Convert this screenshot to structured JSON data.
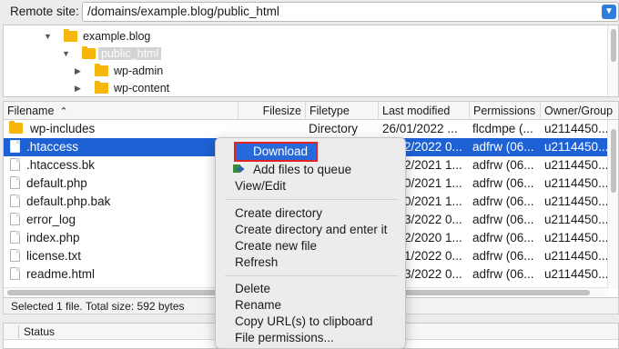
{
  "remote": {
    "label": "Remote site:",
    "path": "/domains/example.blog/public_html"
  },
  "tree": [
    {
      "label": "example.blog",
      "expanded": true
    },
    {
      "label": "public_html",
      "expanded": true,
      "selected": true
    },
    {
      "label": "wp-admin",
      "expanded": false
    },
    {
      "label": "wp-content",
      "expanded": false
    }
  ],
  "columns": {
    "filename": "Filename",
    "filesize": "Filesize",
    "filetype": "Filetype",
    "last_modified": "Last modified",
    "permissions": "Permissions",
    "owner": "Owner/Group"
  },
  "files": [
    {
      "name": "wp-includes",
      "type": "Directory",
      "modified": "26/01/2022 ...",
      "perms": "flcdmpe (...",
      "owner": "u2114450..."
    },
    {
      "name": ".htaccess",
      "type": "",
      "modified": "2/2022 0...",
      "perms": "adfrw (06...",
      "owner": "u2114450..."
    },
    {
      "name": ".htaccess.bk",
      "type": "",
      "modified": "2/2021 1...",
      "perms": "adfrw (06...",
      "owner": "u2114450..."
    },
    {
      "name": "default.php",
      "type": "",
      "modified": "0/2021 1...",
      "perms": "adfrw (06...",
      "owner": "u2114450..."
    },
    {
      "name": "default.php.bak",
      "type": "",
      "modified": "0/2021 1...",
      "perms": "adfrw (06...",
      "owner": "u2114450..."
    },
    {
      "name": "error_log",
      "type": "",
      "modified": "3/2022 0...",
      "perms": "adfrw (06...",
      "owner": "u2114450..."
    },
    {
      "name": "index.php",
      "type": "",
      "modified": "2/2020 1...",
      "perms": "adfrw (06...",
      "owner": "u2114450..."
    },
    {
      "name": "license.txt",
      "type": "",
      "modified": "1/2022 0...",
      "perms": "adfrw (06...",
      "owner": "u2114450..."
    },
    {
      "name": "readme.html",
      "type": "",
      "modified": "3/2022 0...",
      "perms": "adfrw (06...",
      "owner": "u2114450..."
    }
  ],
  "selection_info": "Selected 1 file. Total size: 592 bytes",
  "queue": {
    "status_header": "Status"
  },
  "context_menu": {
    "download": "Download",
    "add_to_queue": "Add files to queue",
    "view_edit": "View/Edit",
    "create_directory": "Create directory",
    "create_directory_enter": "Create directory and enter it",
    "create_file": "Create new file",
    "refresh": "Refresh",
    "delete": "Delete",
    "rename": "Rename",
    "copy_url": "Copy URL(s) to clipboard",
    "file_permissions": "File permissions..."
  },
  "colors": {
    "selection": "#1e61d5",
    "menu_highlight": "#2769da",
    "annotation_box": "#e02424",
    "folder": "#f5b80a"
  }
}
